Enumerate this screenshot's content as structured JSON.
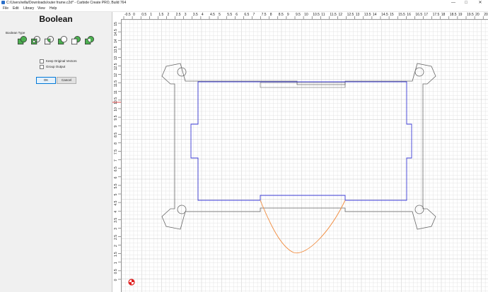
{
  "window": {
    "title": "C:/Users/willa/Downloads/outer frame.c2d* - Carbide Create PRO, Build 764",
    "minimize_icon": "minimize-icon",
    "maximize_icon": "maximize-icon",
    "close_icon": "close-icon"
  },
  "menu": {
    "items": [
      {
        "label": "File"
      },
      {
        "label": "Edit"
      },
      {
        "label": "Library"
      },
      {
        "label": "View"
      },
      {
        "label": "Help"
      }
    ]
  },
  "panel": {
    "title": "Boolean",
    "boolean_type_label": "Boolean Type",
    "boolean_ops": [
      {
        "icon": "boolean-union-icon"
      },
      {
        "icon": "boolean-join-icon"
      },
      {
        "icon": "boolean-intersect-icon"
      },
      {
        "icon": "boolean-subtract-icon"
      },
      {
        "icon": "boolean-reverse-subtract-icon"
      },
      {
        "icon": "boolean-exclude-icon"
      }
    ],
    "keep_original_label": "Keep Original Vectors",
    "keep_original_checked": false,
    "group_output_label": "Group Output",
    "group_output_checked": false,
    "ok_label": "OK",
    "cancel_label": "Cancel"
  },
  "rulers": {
    "top_labels": [
      "-0.5",
      "0",
      "0.5",
      "1",
      "1.5",
      "2",
      "2.5",
      "3",
      "3.5",
      "4",
      "4.5",
      "5",
      "5.5",
      "6",
      "6.5",
      "7",
      "7.5",
      "8",
      "8.5",
      "9",
      "9.5",
      "10",
      "10.5",
      "11",
      "11.5",
      "12",
      "12.5",
      "13",
      "13.5",
      "14",
      "14.5",
      "15",
      "15.5",
      "16",
      "16.5",
      "17",
      "17.5",
      "18",
      "18.5",
      "19",
      "19.5",
      "20",
      "20.5"
    ],
    "left_labels": [
      "15",
      "14.5",
      "14",
      "13.5",
      "13",
      "12.5",
      "12",
      "11.5",
      "11",
      "10.5",
      "10",
      "9.5",
      "9",
      "8.5",
      "8",
      "7.5",
      "7",
      "6.5",
      "6",
      "5.5",
      "5",
      "4.5",
      "4",
      "3.5",
      "3",
      "2.5",
      "2",
      "1.5",
      "1",
      "0.5",
      "0"
    ]
  },
  "colors": {
    "grid_minor": "#e4e4e4",
    "grid_major": "#c9c9c9",
    "selected_vector": "#3b3bd6",
    "unselected_vector": "#666666",
    "arc_vector": "#f08a3c",
    "origin_marker": "#e02020",
    "boolean_green": "#4caf50"
  }
}
